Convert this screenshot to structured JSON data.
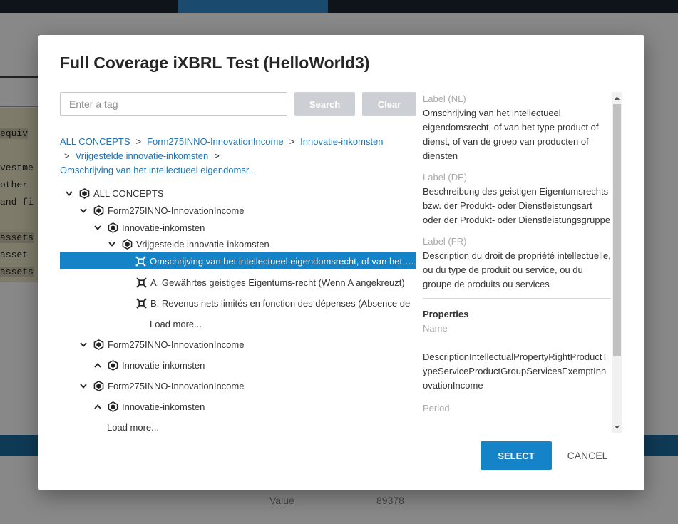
{
  "background": {
    "code_lines": [
      "equiv",
      "vestme",
      "other",
      "and fi",
      "assets",
      " asset",
      "assets"
    ],
    "footer_label": "Value",
    "footer_value": "89378"
  },
  "modal": {
    "title": "Full Coverage iXBRL Test (HelloWorld3)",
    "search": {
      "placeholder": "Enter a tag",
      "value": ""
    },
    "search_button": "Search",
    "clear_button": "Clear",
    "breadcrumb": {
      "items": [
        "ALL CONCEPTS",
        "Form275INNO-InnovationIncome",
        "Innovatie-inkomsten",
        "Vrijgestelde innovatie-inkomsten",
        "Omschrijving van het intellectueel eigendomsr..."
      ],
      "separator": ">"
    },
    "tree": [
      {
        "label": "ALL CONCEPTS",
        "caret": "down",
        "icon": "cube-icon"
      },
      {
        "label": "Form275INNO-InnovationIncome",
        "caret": "down",
        "icon": "cube-icon"
      },
      {
        "label": "Innovatie-inkomsten",
        "caret": "down",
        "icon": "cube-icon"
      },
      {
        "label": "Vrijgestelde innovatie-inkomsten",
        "caret": "down",
        "icon": "cube-icon"
      },
      {
        "label": "Omschrijving van het intellectueel eigendomsrecht, of van het type product of dienst",
        "caret": "",
        "icon": "concept-icon",
        "selected": true
      },
      {
        "label": "A. Gewährtes geistiges Eigentums-recht (Wenn A angekreuzt)",
        "caret": "",
        "icon": "concept-icon"
      },
      {
        "label": "B. Revenus nets limités en fonction des dépenses (Absence de",
        "caret": "",
        "icon": "concept-icon"
      },
      {
        "label": "Load more...",
        "caret": "",
        "icon": ""
      },
      {
        "label": "Form275INNO-InnovationIncome",
        "caret": "down",
        "icon": "cube-icon"
      },
      {
        "label": "Innovatie-inkomsten",
        "caret": "up",
        "icon": "cube-icon"
      },
      {
        "label": "Form275INNO-InnovationIncome",
        "caret": "down",
        "icon": "cube-icon"
      },
      {
        "label": "Innovatie-inkomsten",
        "caret": "up",
        "icon": "cube-icon"
      },
      {
        "label": "Load more...",
        "caret": "",
        "icon": ""
      }
    ],
    "details": {
      "label_nl_title": "Label (NL)",
      "label_nl": "Omschrijving van het intellectueel eigendomsrecht, of van het type product of dienst, of van de groep van producten of diensten",
      "label_de_title": "Label (DE)",
      "label_de": "Beschreibung des geistigen Eigentumsrechts bzw. der Produkt- oder Dienstleistungsart oder der Produkt- oder Dienstleistungsgruppe",
      "label_fr_title": "Label (FR)",
      "label_fr": "Description du droit de propriété intellectuelle, ou du type de produit ou service, ou du groupe de produits ou services",
      "properties_title": "Properties",
      "name_title": "Name",
      "name_value": "DescriptionIntellectualPropertyRightProductTypeServiceProductGroupServicesExemptInnovationIncome",
      "period_title": "Period"
    },
    "select_button": "SELECT",
    "cancel_button": "CANCEL"
  },
  "colors": {
    "accent": "#1583c8",
    "link": "#1d74b5",
    "overlay": "#888888"
  }
}
